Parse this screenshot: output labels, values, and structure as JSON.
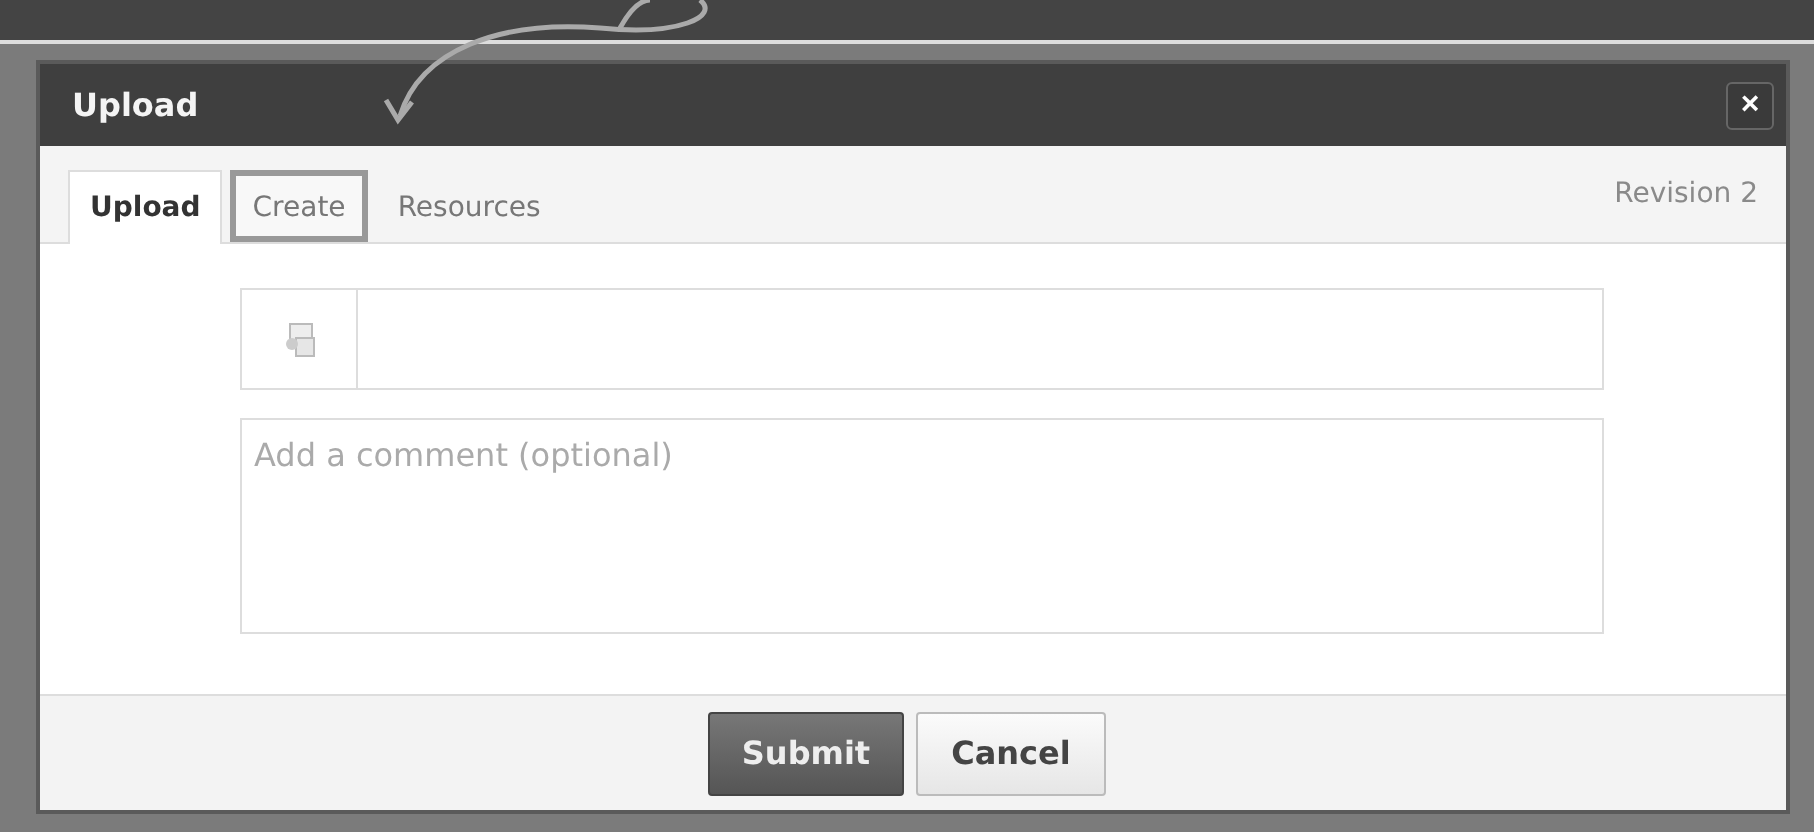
{
  "dialog": {
    "title": "Upload",
    "close": "×"
  },
  "tabs": [
    {
      "label": "Upload",
      "selected": true,
      "highlighted": false
    },
    {
      "label": "Create",
      "selected": false,
      "highlighted": true
    },
    {
      "label": "Resources",
      "selected": false,
      "highlighted": false
    }
  ],
  "revision": "Revision 2",
  "comment": {
    "placeholder": "Add a comment (optional)"
  },
  "buttons": [
    {
      "label": "Submit",
      "kind": "primary"
    },
    {
      "label": "Cancel",
      "kind": "secondary"
    }
  ]
}
